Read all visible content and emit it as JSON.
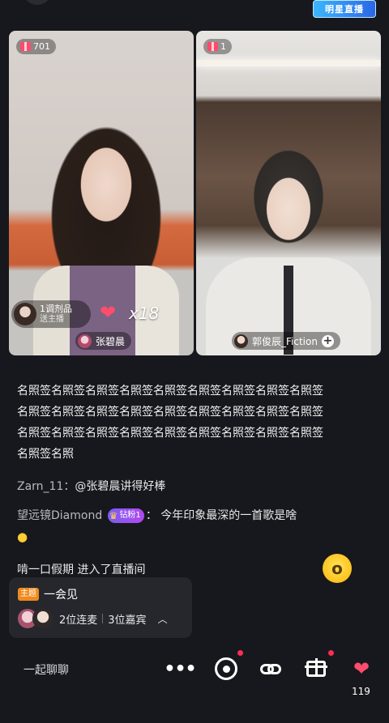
{
  "header": {
    "star_badge": "明星直播"
  },
  "panels": {
    "left": {
      "gift_count": "701",
      "prop_title": "1调剂品",
      "prop_sub": "送主播",
      "multiplier": "x18",
      "name": "张碧晨"
    },
    "right": {
      "gift_count": "1",
      "name": "郭俊辰_Fiction"
    }
  },
  "chat": {
    "messages": [
      {
        "text": "名照签名照签名照签名照签名照签名照签名照签名照签名照签名照签名照签名照签名照签名照签名照签名照签名照签名照签名照签名照签名照签名照签名照签名照签名照签名照签名照签名照签名照"
      },
      {
        "user": "Zarn_11：",
        "text": "@张碧晨讲得好棒"
      },
      {
        "user": "望远镜Diamond",
        "badge": "钻粉1",
        "text": "：  今年印象最深的一首歌是啥"
      },
      {
        "text": "啃一口假期  进入了直播间"
      }
    ]
  },
  "topic": {
    "tag": "主题",
    "title": "一会见",
    "mic_count": "2位连麦",
    "guest_count": "3位嘉宾"
  },
  "bottom": {
    "say": "一起聊聊",
    "like_count": "119"
  },
  "icons": {
    "gift": "gift-icon",
    "heart_hand": "heart-hand-icon",
    "more": "more-dots-icon",
    "record": "record-icon",
    "link": "link-icon",
    "emoji": "surprised-emoji-icon"
  },
  "colors": {
    "background": "#17181d",
    "accent_red": "#ff2d55",
    "topic_tag": "#f08a1d",
    "fan_badge": "#8a55f2"
  }
}
